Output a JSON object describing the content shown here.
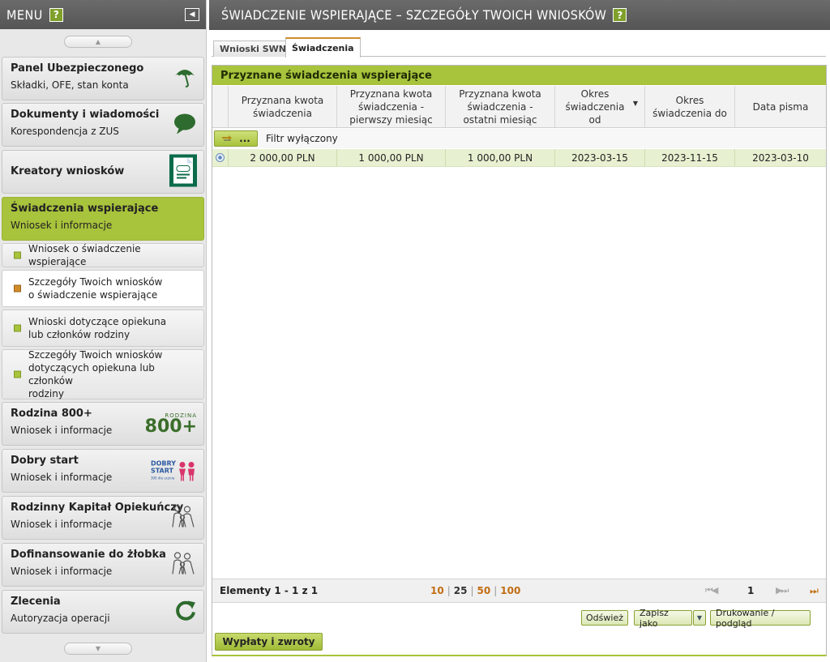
{
  "sidebar": {
    "title": "MENU",
    "help": "?",
    "items": {
      "panel": {
        "title": "Panel Ubezpieczonego",
        "subtitle": "Składki, OFE, stan konta"
      },
      "docs": {
        "title": "Dokumenty i wiadomości",
        "subtitle": "Korespondencja z ZUS"
      },
      "creators": {
        "title": "Kreatory wniosków"
      },
      "swn": {
        "title": "Świadczenia wspierające",
        "subtitle": "Wniosek i informacje"
      },
      "sub1": "Wniosek o świadczenie wspierające",
      "sub2a": "Szczegóły Twoich wniosków",
      "sub2b": "o świadczenie wspierające",
      "sub3a": "Wnioski dotyczące opiekuna",
      "sub3b": "lub członków rodziny",
      "sub4a": "Szczegóły Twoich wniosków",
      "sub4b": "dotyczących opiekuna lub członków",
      "sub4c": "rodziny",
      "r800": {
        "title": "Rodzina 800+",
        "subtitle": "Wniosek i informacje",
        "logo_small": "RODZINA",
        "logo_big": "800+"
      },
      "dobry": {
        "title": "Dobry start",
        "subtitle": "Wniosek i informacje",
        "logo1": "DOBRY",
        "logo2": "START",
        "logo3": "300 dla ucznia"
      },
      "rkp": {
        "title": "Rodzinny Kapitał Opiekuńczy",
        "subtitle": "Wniosek i informacje"
      },
      "zlobek": {
        "title": "Dofinansowanie do żłobka",
        "subtitle": "Wniosek i informacje"
      },
      "zlecenia": {
        "title": "Zlecenia",
        "subtitle": "Autoryzacja operacji"
      }
    }
  },
  "main": {
    "title": "ŚWIADCZENIE WSPIERAJĄCE – SZCZEGÓŁY TWOICH WNIOSKÓW",
    "help": "?",
    "tabs": {
      "t1": "Wnioski SWN",
      "t2": "Świadczenia"
    },
    "panel_title": "Przyznane świadczenia wspierające",
    "columns": {
      "c1": "Przyznana kwota świadczenia",
      "c2": "Przyznana kwota świadczenia - pierwszy miesiąc",
      "c3": "Przyznana kwota świadczenia - ostatni miesiąc",
      "c4": "Okres świadczenia od",
      "c5": "Okres świadczenia do",
      "c6": "Data pisma"
    },
    "filter": {
      "button": "...",
      "text": "Filtr wyłączony"
    },
    "row": {
      "kwota": "2 000,00 PLN",
      "pierwszy": "1 000,00 PLN",
      "ostatni": "1 000,00 PLN",
      "od": "2023-03-15",
      "do": "2023-11-15",
      "data": "2023-03-10"
    },
    "pager": {
      "count": "Elementy 1 - 1 z 1",
      "sizes": {
        "s10": "10",
        "s25": "25",
        "s50": "50",
        "s100": "100"
      },
      "page": "1"
    },
    "actions": {
      "refresh": "Odśwież",
      "save_as": "Zapisz jako",
      "print": "Drukowanie / podgląd"
    },
    "payments_button": "Wypłaty i zwroty"
  }
}
